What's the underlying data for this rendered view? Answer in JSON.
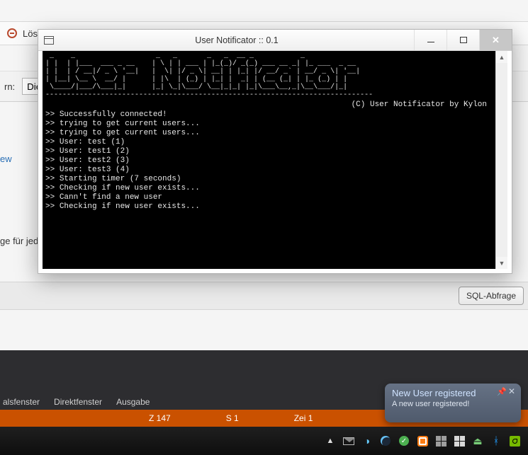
{
  "bg": {
    "delete_label_fragment": "Lös",
    "filter_label_fragment": "rn:",
    "filter_value": "Die",
    "link_fragment": "ew",
    "sort_text_fragment": "ge für jed",
    "sql_button": "SQL-Abfrage"
  },
  "ide": {
    "tabs": [
      "alsfenster",
      "Direktfenster",
      "Ausgabe"
    ],
    "status": {
      "col": "Z 147",
      "sel": "S 1",
      "line": "Zei 1"
    }
  },
  "window": {
    "title": "User Notificator :: 0.1",
    "copyright": "(C) User Notificator by Kylon",
    "ascii": " _    _                   _   _       _   _  __ _           _\n| |  | |___  ___ _ __    | \\ | | ___ | |_(_)/ _(_) ___ __ _| |_ ___  _ __\n| |  | / __|/ _ \\ '__|   |  \\| |/ _ \\| __| | |_| |/ __/ _` | __/ _ \\| '__|\n| |__| \\__ \\  __/ |      | |\\  | (_) | |_| |  _| | (__ (_| | |_ (_) | |\n \\____/|___/\\___|_|      |_| \\_|\\___/ \\__|_|_| |_|\\___\\__,_|\\__\\___/|_|\n-----------------------------------------------------------------------------",
    "log": [
      "Successfully connected!",
      "trying to get current users...",
      "trying to get current users...",
      "User: test (1)",
      "User: test1 (2)",
      "User: test2 (3)",
      "User: test3 (4)",
      "Starting timer (7 seconds)",
      "Checking if new user exists...",
      "Cann't find a new user",
      "Checking if new user exists..."
    ]
  },
  "toast": {
    "title": "New User registered",
    "body": "A new user registered!"
  }
}
